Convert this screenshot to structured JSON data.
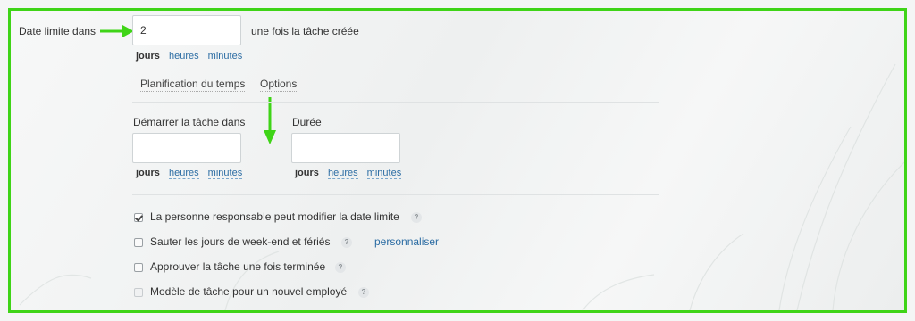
{
  "deadline": {
    "label": "Date limite dans",
    "value": "2",
    "suffix": "une fois la tâche créée",
    "units": {
      "active": "jours",
      "link1": "heures",
      "link2": "minutes"
    }
  },
  "tabs": {
    "planning": "Planification du temps",
    "options": "Options"
  },
  "start": {
    "label": "Démarrer la tâche dans",
    "value": "",
    "units": {
      "active": "jours",
      "link1": "heures",
      "link2": "minutes"
    }
  },
  "duration": {
    "label": "Durée",
    "value": "",
    "units": {
      "active": "jours",
      "link1": "heures",
      "link2": "minutes"
    }
  },
  "options": {
    "responsible_can_change": "La personne responsable peut modifier la date limite",
    "skip_weekends": "Sauter les jours de week-end et fériés",
    "customize_link": "personnaliser",
    "approve_task": "Approuver la tâche une fois terminée",
    "template_new_employee": "Modèle de tâche pour un nouvel employé",
    "help_symbol": "?"
  },
  "colors": {
    "highlight": "#3fd417",
    "link": "#2b6ca3"
  }
}
